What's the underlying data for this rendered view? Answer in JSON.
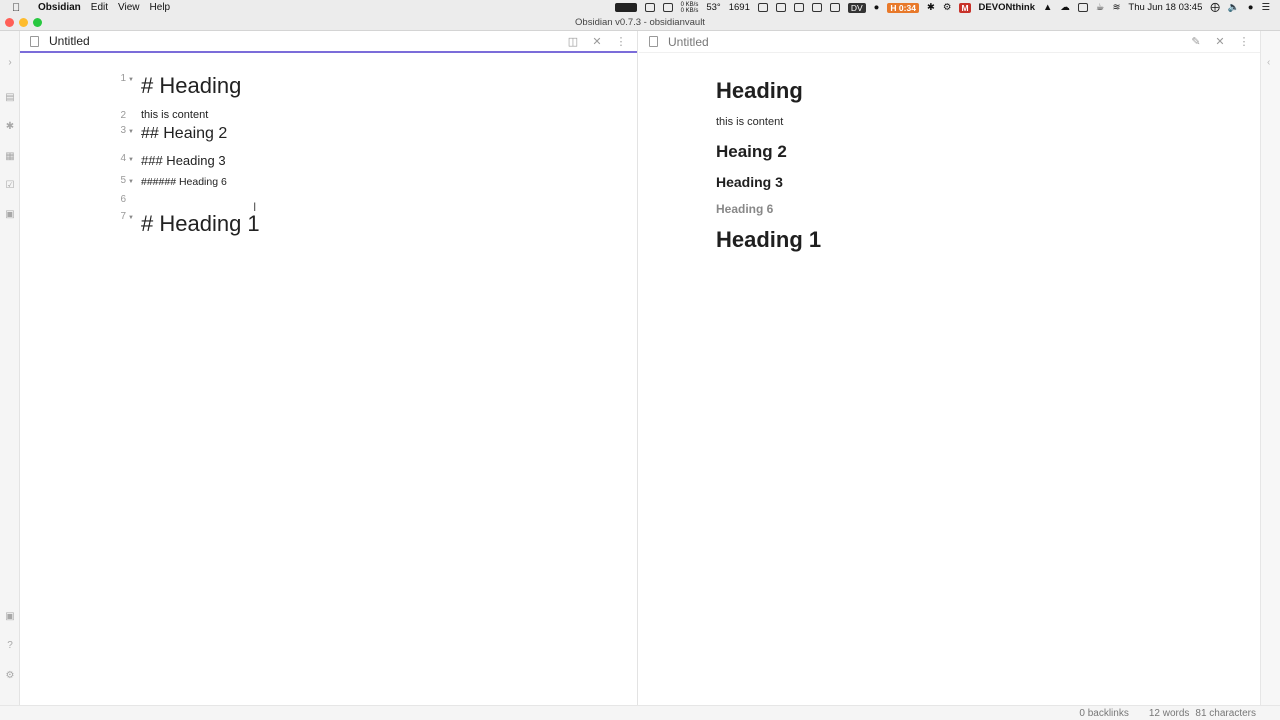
{
  "menubar": {
    "apple_icon": "apple-icon",
    "items": [
      "Obsidian",
      "Edit",
      "View",
      "Help"
    ],
    "status": {
      "net_up": "0 KB/s",
      "net_down": "0 KB/s",
      "temperature": "53°",
      "fan": "1691",
      "timer": "0:34",
      "dv_badge": "DV",
      "devonthink": "DEVONthink",
      "datetime": "Thu Jun 18  03:45"
    }
  },
  "window": {
    "title": "Obsidian v0.7.3 - obsidianvault"
  },
  "ribbon": {
    "icons": [
      "expand-icon",
      "open-file-icon",
      "graph-icon",
      "plugins-icon",
      "daily-note-icon",
      "archive-icon",
      "vault-icon",
      "help-icon",
      "settings-icon"
    ]
  },
  "left_pane": {
    "title": "Untitled",
    "actions": [
      "preview-toggle-icon",
      "close-icon",
      "more-options-icon"
    ],
    "lines": [
      {
        "num": "1",
        "text": "# Heading",
        "fold": true
      },
      {
        "num": "2",
        "text": "this is content",
        "fold": false
      },
      {
        "num": "3",
        "text": "## Heaing 2",
        "fold": true
      },
      {
        "num": "4",
        "text": "### Heading 3",
        "fold": true
      },
      {
        "num": "5",
        "text": "###### Heading 6",
        "fold": true
      },
      {
        "num": "6",
        "text": "",
        "fold": false
      },
      {
        "num": "7",
        "text": "# Heading 1",
        "fold": true
      }
    ]
  },
  "right_pane": {
    "title": "Untitled",
    "actions": [
      "edit-icon",
      "close-icon",
      "more-options-icon"
    ],
    "blocks": [
      {
        "type": "h1",
        "text": "Heading"
      },
      {
        "type": "p",
        "text": "this is content"
      },
      {
        "type": "h2",
        "text": "Heaing 2"
      },
      {
        "type": "h3",
        "text": "Heading 3"
      },
      {
        "type": "h6",
        "text": "Heading 6"
      },
      {
        "type": "h1",
        "text": "Heading 1"
      }
    ]
  },
  "statusbar": {
    "backlinks": "0 backlinks",
    "words": "12 words",
    "characters": "81 characters"
  }
}
